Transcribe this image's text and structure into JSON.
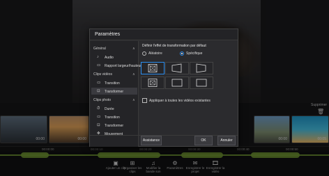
{
  "dialog": {
    "title": "Paramètres",
    "sidebar": {
      "sections": [
        {
          "header": "Général",
          "items": [
            {
              "label": "Audio",
              "icon": "music-note-icon"
            },
            {
              "label": "Rapport largeur/hauteur",
              "icon": "aspect-ratio-icon"
            }
          ]
        },
        {
          "header": "Clips vidéos",
          "items": [
            {
              "label": "Transition",
              "icon": "transition-icon"
            },
            {
              "label": "Transformer",
              "icon": "transform-icon",
              "active": true
            }
          ]
        },
        {
          "header": "Clips photo",
          "items": [
            {
              "label": "Durée",
              "icon": "duration-icon"
            },
            {
              "label": "Transition",
              "icon": "transition-icon"
            },
            {
              "label": "Transformer",
              "icon": "transform-icon"
            },
            {
              "label": "Mouvement",
              "icon": "movement-icon"
            }
          ]
        }
      ]
    },
    "content": {
      "heading": "Définir l'effet de transformation par défaut",
      "radio_random": "Aléatoire",
      "radio_specific": "Spécifique",
      "selected_radio": "Spécifique",
      "apply_all_label": "Appliquer à toutes les vidéos existantes",
      "apply_all_checked": false
    },
    "buttons": {
      "assistance": "Assistance",
      "ok": "OK",
      "cancel": "Annuler"
    }
  },
  "timeline": {
    "delete_label": "Supprimer",
    "clip_times": [
      "00:00",
      "00:00",
      "00:00",
      "00:05"
    ],
    "ruler_labels": [
      "00:00:00",
      "00:00:10",
      "00:00:20",
      "00:00:30",
      "00:00:40",
      "00:00:50"
    ]
  },
  "toolbar": {
    "items": [
      {
        "label": "Ajouter un clip",
        "icon": "add-clip-icon"
      },
      {
        "label": "Organiser les clips",
        "icon": "grid-icon"
      },
      {
        "label": "Modifier la bande son",
        "icon": "music-icon"
      },
      {
        "label": "Paramètres",
        "icon": "gear-icon"
      },
      {
        "label": "Enregistrer le projet",
        "icon": "save-icon"
      },
      {
        "label": "Enregistrer la vidéo",
        "icon": "export-icon"
      }
    ]
  },
  "colors": {
    "accent": "#2b8ef0",
    "dialog_bg": "#2b2b2e",
    "waveform": "#6a8f30"
  }
}
